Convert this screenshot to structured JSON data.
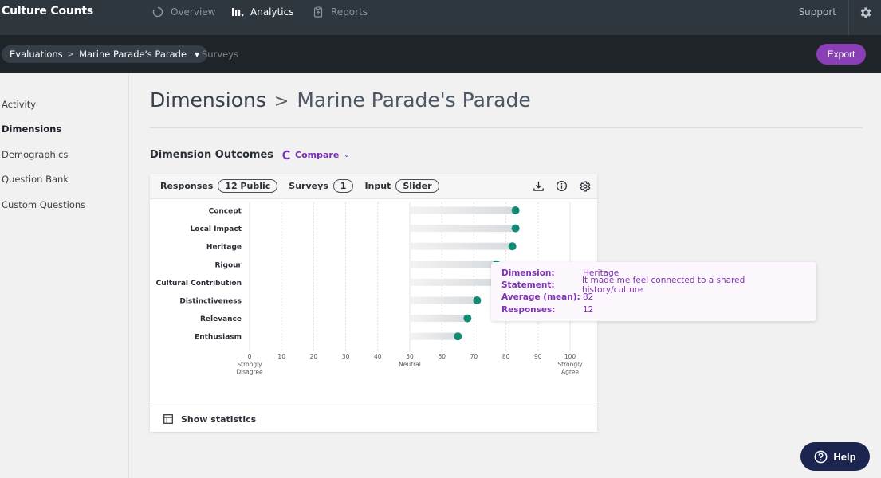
{
  "app": {
    "title": "Culture Counts"
  },
  "topnav": {
    "items": [
      {
        "label": "Overview",
        "icon": "spinner-circle-icon",
        "active": false
      },
      {
        "label": "Analytics",
        "icon": "bar-chart-icon",
        "active": true
      },
      {
        "label": "Reports",
        "icon": "clipboard-icon",
        "active": false
      }
    ],
    "support_label": "Support",
    "settings_icon": "gear-icon"
  },
  "subbar": {
    "breadcrumb": {
      "root": "Evaluations",
      "separator": ">",
      "current": "Marine Parade's Parade"
    },
    "surveys_label": "Surveys",
    "export_label": "Export"
  },
  "sidebar": {
    "items": [
      {
        "label": "Activity",
        "active": false
      },
      {
        "label": "Dimensions",
        "active": true
      },
      {
        "label": "Demographics",
        "active": false
      },
      {
        "label": "Question Bank",
        "active": false
      },
      {
        "label": "Custom Questions",
        "active": false
      }
    ]
  },
  "page": {
    "title": "Dimensions",
    "separator": ">",
    "subtitle": "Marine Parade's Parade"
  },
  "section": {
    "title": "Dimension Outcomes",
    "compare_label": "Compare"
  },
  "card": {
    "responses_label": "Responses",
    "responses_value": "12 Public",
    "surveys_label": "Surveys",
    "surveys_value": "1",
    "input_label": "Input",
    "input_value": "Slider",
    "footer_label": "Show statistics"
  },
  "tooltip": {
    "dimension_key": "Dimension:",
    "dimension_value": "Heritage",
    "statement_key": "Statement:",
    "statement_value": "It made me feel connected to a shared history/culture",
    "average_key": "Average (mean):",
    "average_value": "82",
    "responses_key": "Responses:",
    "responses_value": "12"
  },
  "help": {
    "label": "Help"
  },
  "colors": {
    "accent": "#8a3fb7",
    "dot": "#138a73",
    "help": "#1b2550"
  },
  "chart_data": {
    "type": "lollipop",
    "categories": [
      "Concept",
      "Local Impact",
      "Heritage",
      "Rigour",
      "Cultural Contribution",
      "Distinctiveness",
      "Relevance",
      "Enthusiasm"
    ],
    "values": [
      83,
      83,
      82,
      77,
      77,
      71,
      68,
      65
    ],
    "baseline": 50,
    "xlim": [
      0,
      100
    ],
    "xticks": [
      0,
      10,
      20,
      30,
      40,
      50,
      60,
      70,
      80,
      90,
      100
    ],
    "tick_sublabels": {
      "0": "Strongly Disagree",
      "50": "Neutral",
      "100": "Strongly Agree"
    },
    "grid": true,
    "title": "",
    "xlabel": "",
    "ylabel": ""
  }
}
